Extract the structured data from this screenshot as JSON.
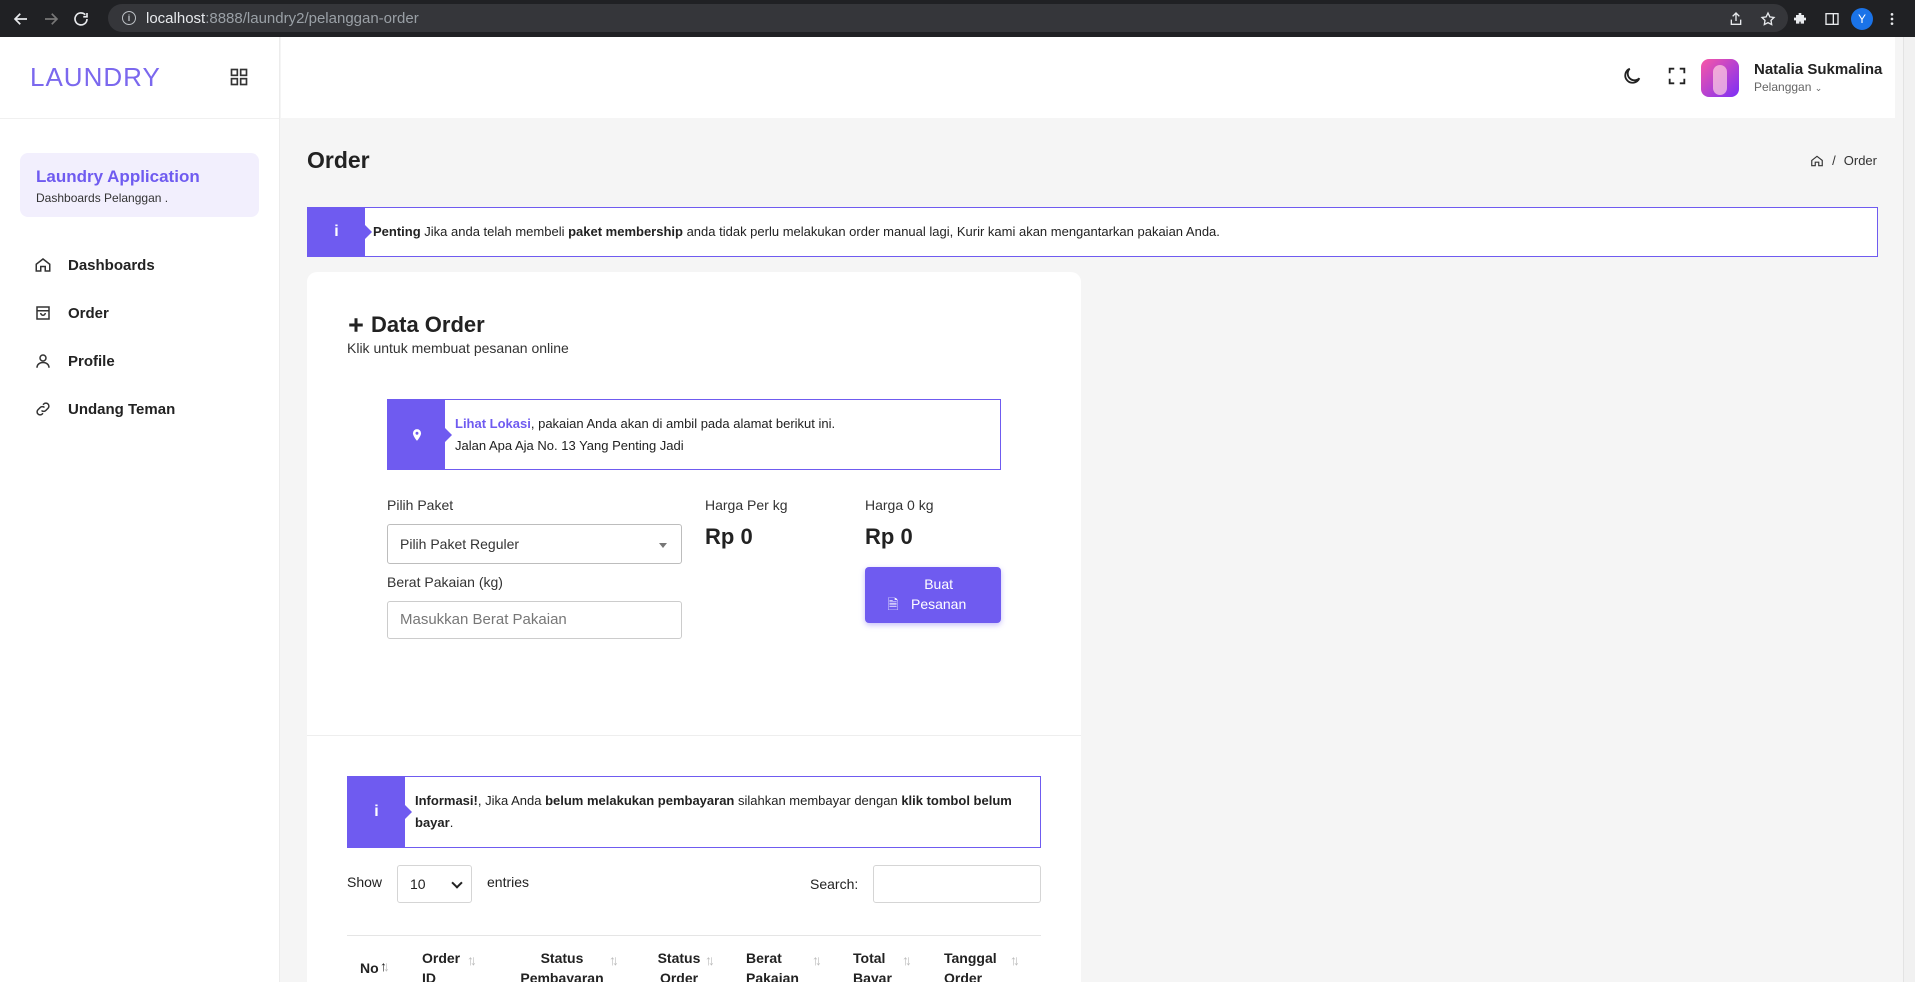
{
  "browser": {
    "url_host": "localhost",
    "url_path": ":8888/laundry2/pelanggan-order",
    "profile_initial": "Y"
  },
  "sidebar": {
    "logo": "LAUNDRY",
    "app_title": "Laundry Application",
    "app_subtitle": "Dashboards Pelanggan .",
    "items": [
      {
        "label": "Dashboards",
        "icon": "home-icon"
      },
      {
        "label": "Order",
        "icon": "bag-icon"
      },
      {
        "label": "Profile",
        "icon": "user-icon"
      },
      {
        "label": "Undang Teman",
        "icon": "link-icon"
      }
    ]
  },
  "header": {
    "user_name": "Natalia Sukmalina",
    "user_role": "Pelanggan"
  },
  "page": {
    "title": "Order",
    "breadcrumb_current": "Order"
  },
  "alert_top": {
    "bold1": "Penting",
    "text1": " Jika anda telah membeli ",
    "bold2": "paket membership",
    "text2": " anda tidak perlu melakukan order manual lagi, Kurir kami akan mengantarkan pakaian Anda."
  },
  "order_card": {
    "title": "Data Order",
    "subtitle": "Klik untuk membuat pesanan online",
    "location_link": "Lihat Lokasi",
    "location_text": ", pakaian Anda akan di ambil pada alamat berikut ini.",
    "address": "Jalan Apa Aja No. 13 Yang Penting Jadi",
    "package_label": "Pilih Paket",
    "package_value": "Pilih Paket Reguler",
    "price_per_kg_label": "Harga Per kg",
    "price_per_kg": "Rp 0",
    "price_total_label": "Harga 0 kg",
    "price_total": "Rp 0",
    "weight_label": "Berat Pakaian (kg)",
    "weight_placeholder": "Masukkan Berat Pakaian",
    "button_label": "Buat Pesanan"
  },
  "alert_info": {
    "bold1": "Informasi!",
    "text1": ", Jika Anda ",
    "bold2": "belum melakukan pembayaran",
    "text2": " silahkan membayar dengan ",
    "bold3": "klik tombol belum bayar",
    "text3": "."
  },
  "table": {
    "show_label": "Show",
    "entries_value": "10",
    "entries_label": "entries",
    "search_label": "Search:",
    "columns": [
      {
        "l1": "No",
        "l2": ""
      },
      {
        "l1": "Order",
        "l2": "ID"
      },
      {
        "l1": "Status",
        "l2": "Pembayaran"
      },
      {
        "l1": "Status",
        "l2": "Order"
      },
      {
        "l1": "Berat",
        "l2": "Pakaian"
      },
      {
        "l1": "Total",
        "l2": "Bayar"
      },
      {
        "l1": "Tanggal",
        "l2": "Order"
      }
    ]
  }
}
